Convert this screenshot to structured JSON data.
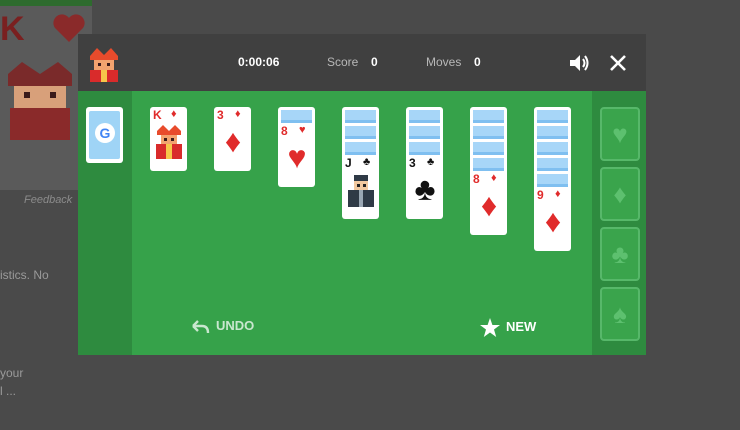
{
  "background": {
    "card_rank": "K",
    "feedback_text": "Feedback",
    "line1_text": "istics. No",
    "line2_text": "your",
    "line3_text": "l ..."
  },
  "header": {
    "timer": "0:00:06",
    "score_label": "Score",
    "score_value": "0",
    "moves_label": "Moves",
    "moves_value": "0"
  },
  "stock": {
    "logo_letter": "G"
  },
  "piles": [
    {
      "face_down": 0,
      "face_up": {
        "rank": "K",
        "suit": "♦",
        "color": "red",
        "center": "king"
      }
    },
    {
      "face_down": 0,
      "face_up": {
        "rank": "3",
        "suit": "♦",
        "color": "red",
        "center": "♦"
      }
    },
    {
      "face_down": 1,
      "face_up": {
        "rank": "8",
        "suit": "♥",
        "color": "red",
        "center": "♥"
      }
    },
    {
      "face_down": 3,
      "face_up": {
        "rank": "J",
        "suit": "♣",
        "color": "black",
        "center": "jack"
      }
    },
    {
      "face_down": 3,
      "face_up": {
        "rank": "3",
        "suit": "♣",
        "color": "black",
        "center": "♣"
      }
    },
    {
      "face_down": 4,
      "face_up": {
        "rank": "8",
        "suit": "♦",
        "color": "red",
        "center": "♦"
      }
    },
    {
      "face_down": 5,
      "face_up": {
        "rank": "9",
        "suit": "♦",
        "color": "red",
        "center": "♦"
      }
    }
  ],
  "foundations": [
    {
      "suit": "♥",
      "icon": "heart-icon"
    },
    {
      "suit": "♦",
      "icon": "diamond-icon"
    },
    {
      "suit": "♣",
      "icon": "club-icon"
    },
    {
      "suit": "♠",
      "icon": "spade-icon"
    }
  ],
  "actions": {
    "undo_label": "UNDO",
    "new_label": "NEW"
  },
  "colors": {
    "table": "#36a24a",
    "side_columns": "#2e8b3f",
    "header": "#404040",
    "red_suit": "#e02b2b"
  }
}
